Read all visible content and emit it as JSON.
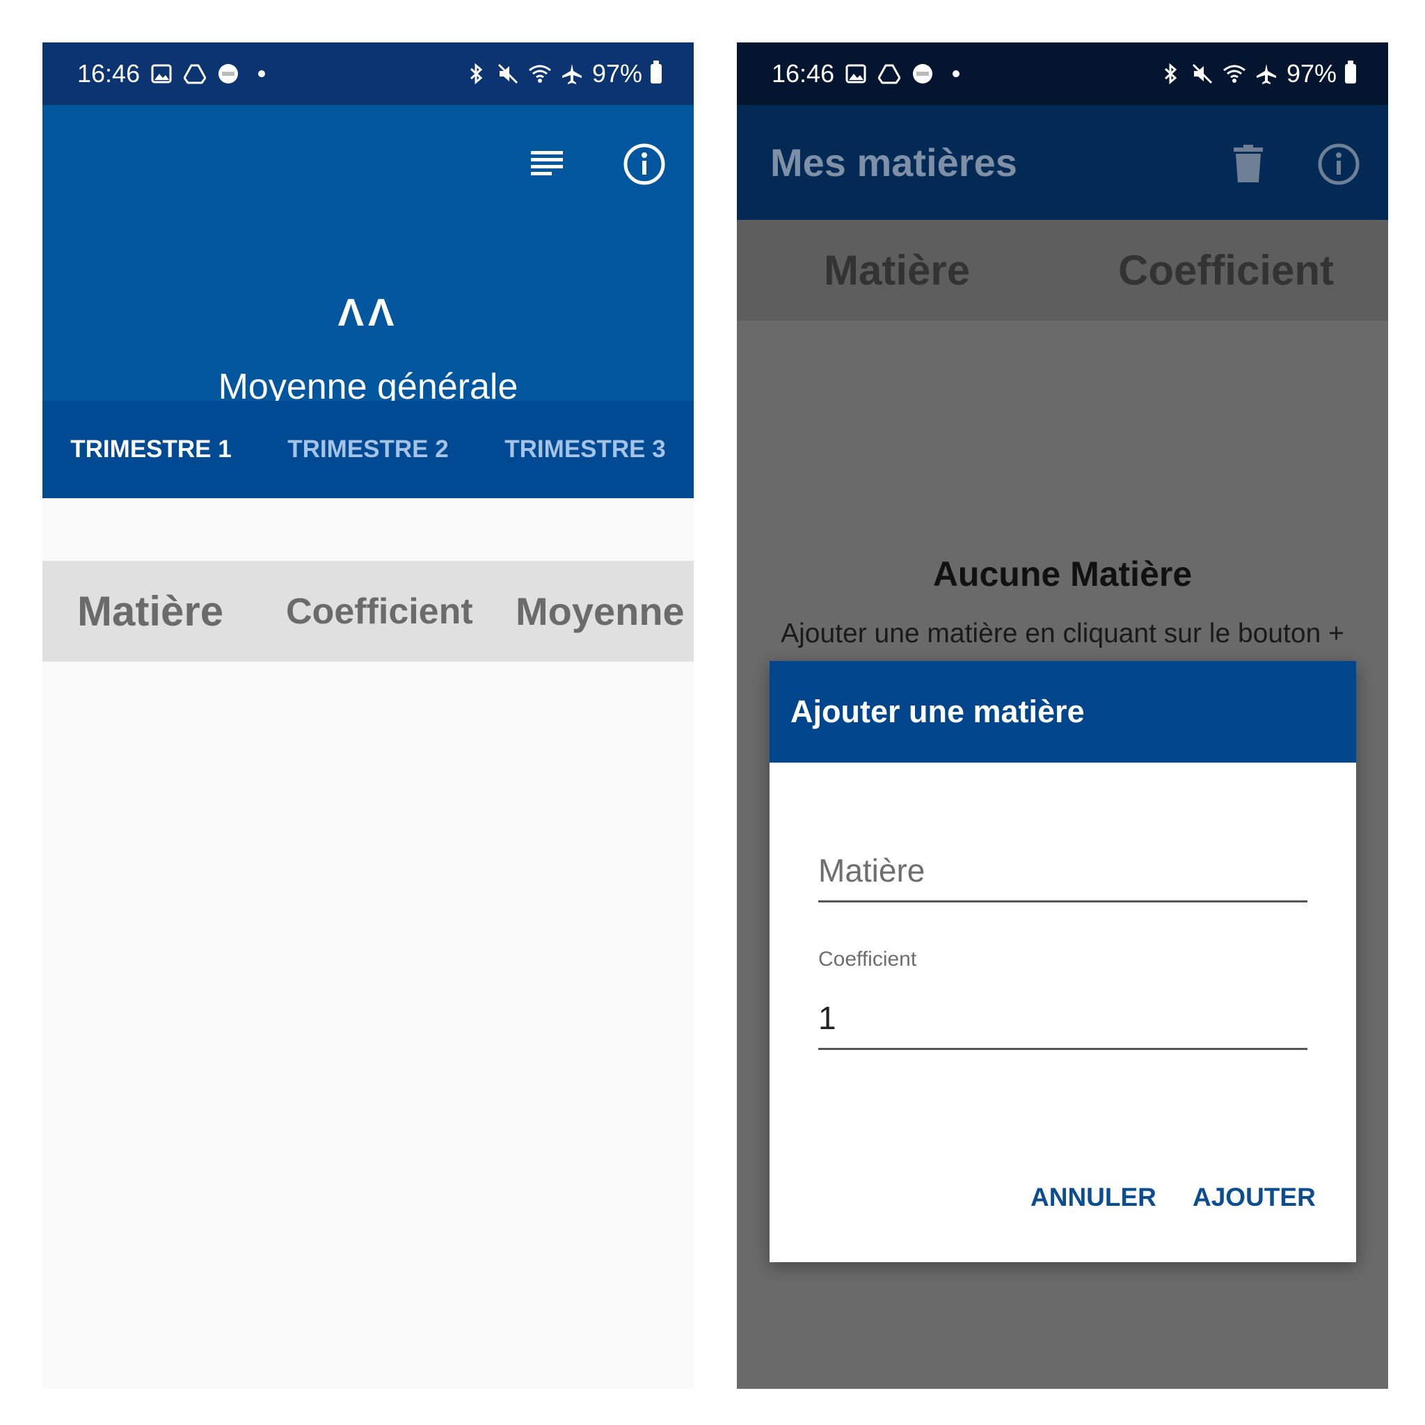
{
  "status_bar": {
    "time": "16:46",
    "battery": "97%"
  },
  "left_screen": {
    "average_value": "ΛΛ",
    "average_label": "Moyenne générale",
    "tabs": [
      {
        "label": "TRIMESTRE 1",
        "active": true
      },
      {
        "label": "TRIMESTRE 2",
        "active": false
      },
      {
        "label": "TRIMESTRE 3",
        "active": false
      }
    ],
    "columns": [
      "Matière",
      "Coefficient",
      "Moyenne"
    ]
  },
  "right_screen": {
    "title": "Mes matières",
    "columns": [
      "Matière",
      "Coefficient"
    ],
    "empty_title": "Aucune Matière",
    "empty_text": "Ajouter une matière en cliquant sur le bouton +",
    "dialog": {
      "title": "Ajouter une matière",
      "subject_placeholder": "Matière",
      "coefficient_label": "Coefficient",
      "coefficient_value": "1",
      "cancel_label": "ANNULER",
      "add_label": "AJOUTER"
    }
  },
  "colors": {
    "primary": "#02569E",
    "tab_bar": "#004A93",
    "dialog_header": "#01458C",
    "button_text": "#0B4D8F"
  },
  "icons": [
    "image-icon",
    "drive-icon",
    "wear-icon",
    "bluetooth-icon",
    "mute-icon",
    "wifi-icon",
    "airplane-icon",
    "battery-icon",
    "list-icon",
    "info-icon",
    "trash-icon"
  ]
}
